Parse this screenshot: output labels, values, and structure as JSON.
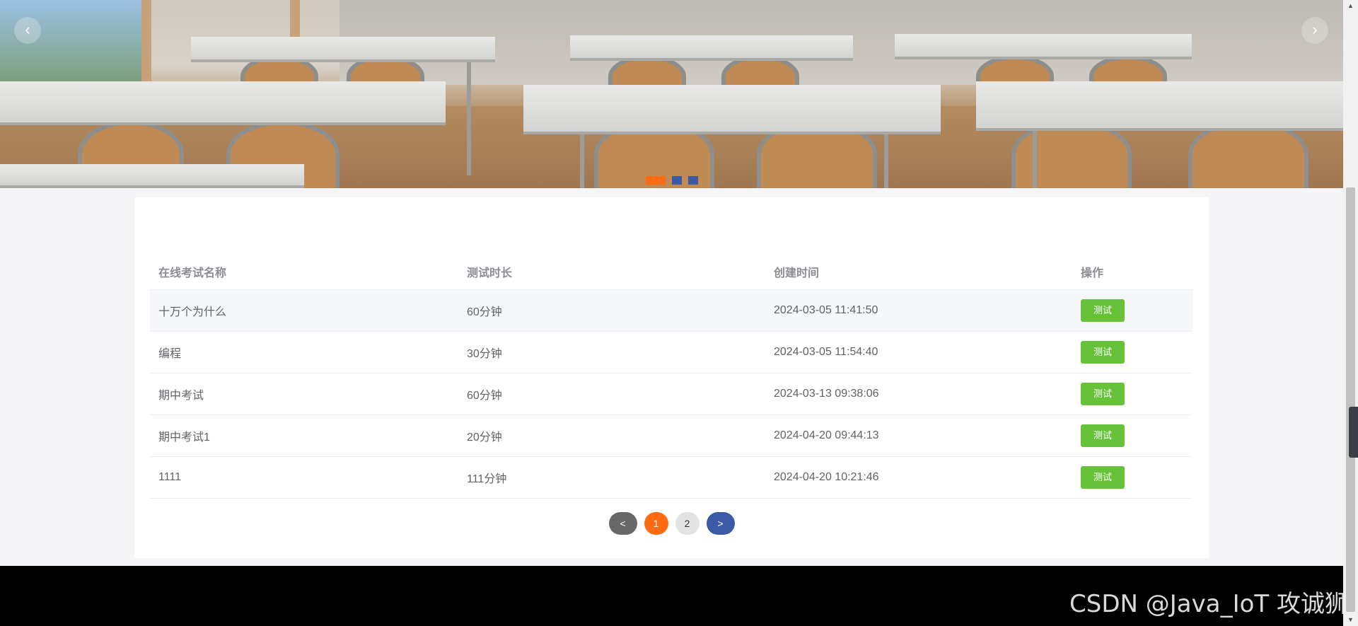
{
  "banner": {
    "prev_label": "‹",
    "next_label": "›",
    "slides": 3,
    "active_slide": 1
  },
  "table": {
    "headers": [
      "在线考试名称",
      "测试时长",
      "创建时间",
      "操作"
    ],
    "rows": [
      {
        "name": "十万个为什么",
        "duration": "60分钟",
        "created": "2024-03-05 11:41:50",
        "action": "测试"
      },
      {
        "name": "编程",
        "duration": "30分钟",
        "created": "2024-03-05 11:54:40",
        "action": "测试"
      },
      {
        "name": "期中考试",
        "duration": "60分钟",
        "created": "2024-03-13 09:38:06",
        "action": "测试"
      },
      {
        "name": "期中考试1",
        "duration": "20分钟",
        "created": "2024-04-20 09:44:13",
        "action": "测试"
      },
      {
        "name": "1111",
        "duration": "111分钟",
        "created": "2024-04-20 10:21:46",
        "action": "测试"
      }
    ]
  },
  "pagination": {
    "prev": "<",
    "pages": [
      "1",
      "2"
    ],
    "current": "1",
    "next": ">"
  },
  "watermark": "CSDN @Java_IoT 攻诚狮",
  "colors": {
    "accent": "#ff6a13",
    "primary": "#3b5aa6",
    "success": "#67c23a",
    "footer": "#000000"
  }
}
